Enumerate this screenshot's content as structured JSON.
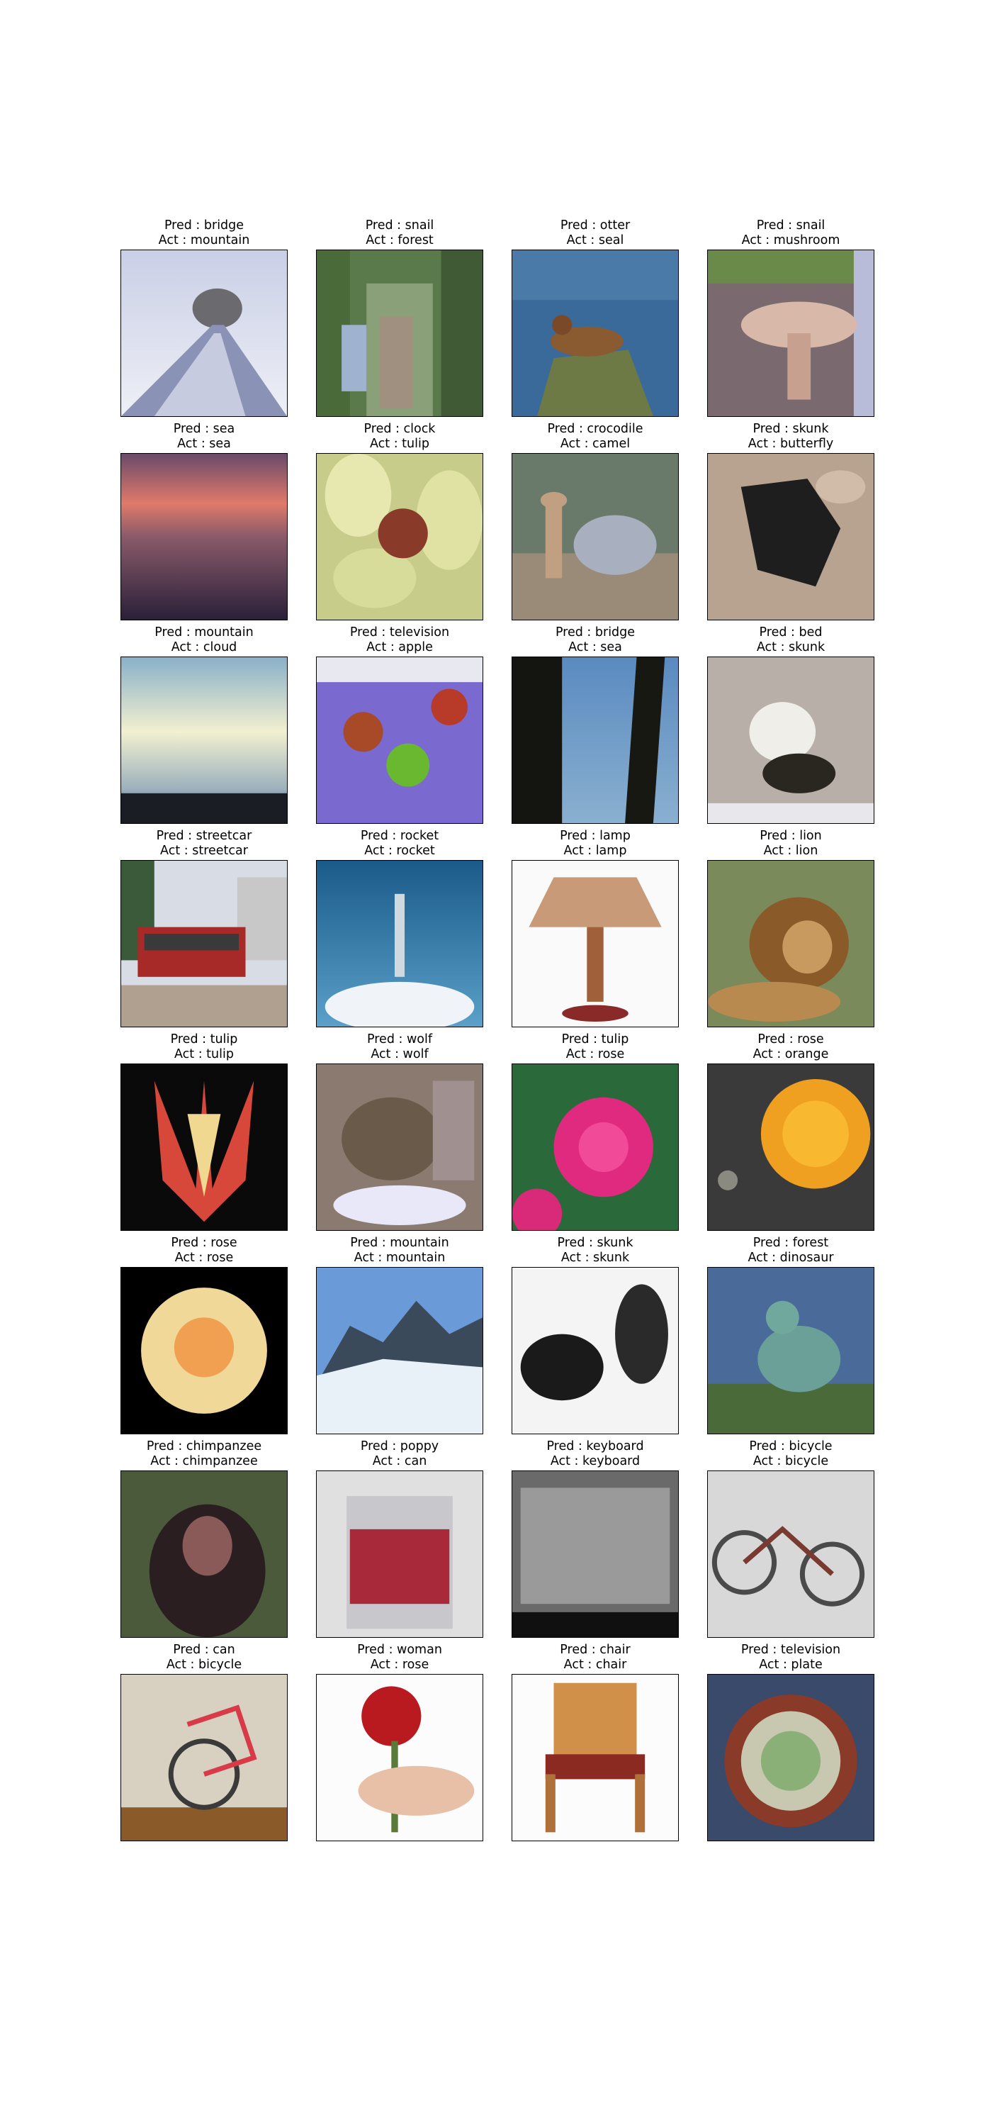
{
  "figure": {
    "pred_prefix": "Pred : ",
    "act_prefix": "Act : ",
    "panels": [
      {
        "pred": "bridge",
        "act": "mountain",
        "scene": "mountain"
      },
      {
        "pred": "snail",
        "act": "forest",
        "scene": "forest"
      },
      {
        "pred": "otter",
        "act": "seal",
        "scene": "seal"
      },
      {
        "pred": "snail",
        "act": "mushroom",
        "scene": "mushroom"
      },
      {
        "pred": "sea",
        "act": "sea",
        "scene": "sunset_sea"
      },
      {
        "pred": "clock",
        "act": "tulip",
        "scene": "lily"
      },
      {
        "pred": "crocodile",
        "act": "camel",
        "scene": "camel"
      },
      {
        "pred": "skunk",
        "act": "butterfly",
        "scene": "butterfly"
      },
      {
        "pred": "mountain",
        "act": "cloud",
        "scene": "cloud"
      },
      {
        "pred": "television",
        "act": "apple",
        "scene": "apples"
      },
      {
        "pred": "bridge",
        "act": "sea",
        "scene": "sea_trees"
      },
      {
        "pred": "bed",
        "act": "skunk",
        "scene": "skunk_white"
      },
      {
        "pred": "streetcar",
        "act": "streetcar",
        "scene": "streetcar"
      },
      {
        "pred": "rocket",
        "act": "rocket",
        "scene": "rocket"
      },
      {
        "pred": "lamp",
        "act": "lamp",
        "scene": "lamp"
      },
      {
        "pred": "lion",
        "act": "lion",
        "scene": "lion"
      },
      {
        "pred": "tulip",
        "act": "tulip",
        "scene": "tulip"
      },
      {
        "pred": "wolf",
        "act": "wolf",
        "scene": "wolf"
      },
      {
        "pred": "tulip",
        "act": "rose",
        "scene": "rose_pink"
      },
      {
        "pred": "rose",
        "act": "orange",
        "scene": "orange"
      },
      {
        "pred": "rose",
        "act": "rose",
        "scene": "rose_yellow"
      },
      {
        "pred": "mountain",
        "act": "mountain",
        "scene": "snow_mountain"
      },
      {
        "pred": "skunk",
        "act": "skunk",
        "scene": "skunks_black"
      },
      {
        "pred": "forest",
        "act": "dinosaur",
        "scene": "dinosaur"
      },
      {
        "pred": "chimpanzee",
        "act": "chimpanzee",
        "scene": "chimpanzee"
      },
      {
        "pred": "poppy",
        "act": "can",
        "scene": "can"
      },
      {
        "pred": "keyboard",
        "act": "keyboard",
        "scene": "keyboard"
      },
      {
        "pred": "bicycle",
        "act": "bicycle",
        "scene": "bicycle"
      },
      {
        "pred": "can",
        "act": "bicycle",
        "scene": "bicycle_indoor"
      },
      {
        "pred": "woman",
        "act": "rose",
        "scene": "rose_hand"
      },
      {
        "pred": "chair",
        "act": "chair",
        "scene": "chair"
      },
      {
        "pred": "television",
        "act": "plate",
        "scene": "plate"
      }
    ]
  }
}
